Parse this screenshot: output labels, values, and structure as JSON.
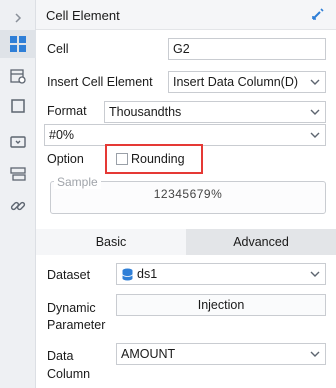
{
  "header": {
    "title": "Cell Element",
    "edit_icon": "pencil-icon"
  },
  "rail": {
    "items": [
      {
        "icon": "chevron-right-icon"
      },
      {
        "icon": "grid-icon",
        "active": true
      },
      {
        "icon": "attributes-icon"
      },
      {
        "icon": "square-border-icon"
      },
      {
        "icon": "widget-icon"
      },
      {
        "icon": "condition-stack-icon"
      },
      {
        "icon": "link-icon"
      }
    ]
  },
  "cell": {
    "label": "Cell",
    "value": "G2"
  },
  "insert": {
    "label": "Insert Cell Element",
    "value": "Insert Data Column(D)"
  },
  "format": {
    "label": "Format",
    "type_value": "Thousandths",
    "pattern_value": "#0%"
  },
  "option": {
    "label": "Option",
    "rounding_label": "Rounding",
    "rounding_checked": false
  },
  "sample": {
    "legend": "Sample",
    "value": "12345679%"
  },
  "tabs": {
    "basic": "Basic",
    "advanced": "Advanced",
    "active": "basic"
  },
  "dataset": {
    "label": "Dataset",
    "value": "ds1"
  },
  "dynamic_parameter": {
    "label_line1": "Dynamic",
    "label_line2": "Parameter",
    "button": "Injection"
  },
  "data_column": {
    "label_line1": "Data",
    "label_line2": "Column",
    "value": "AMOUNT"
  },
  "colors": {
    "highlight": "#e53935",
    "accent": "#2f7fd7"
  }
}
